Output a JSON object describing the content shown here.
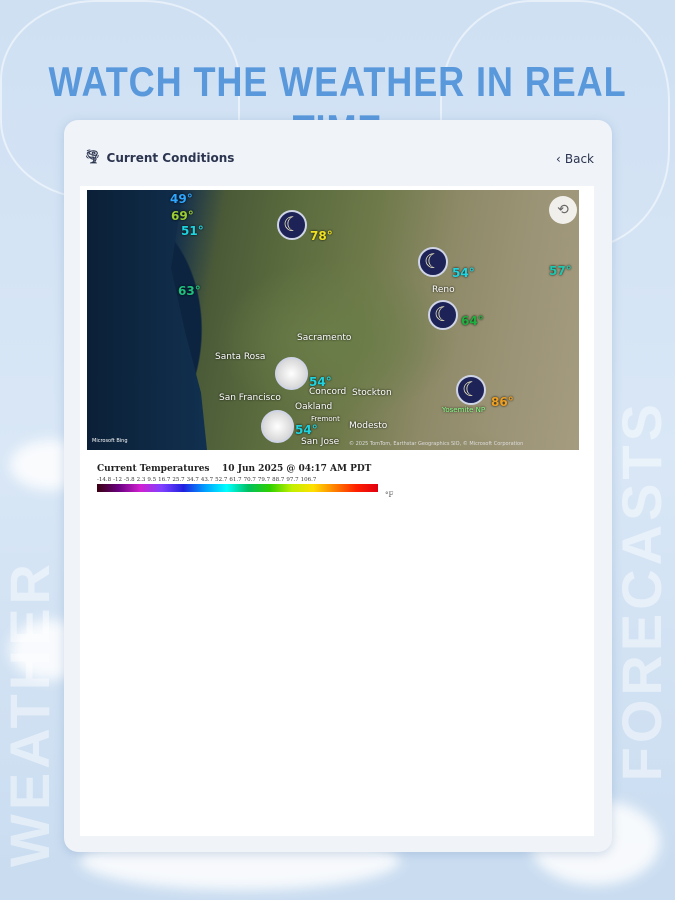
{
  "headline": "WATCH THE WEATHER IN REAL TIME",
  "side_left": "WEATHER",
  "side_right": "FORECASTS",
  "header": {
    "title": "Current Conditions",
    "back_label": "Back"
  },
  "map": {
    "temps": [
      {
        "v": "49°",
        "color": "#2ea6ff"
      },
      {
        "v": "69°",
        "color": "#9acd32"
      },
      {
        "v": "51°",
        "color": "#1ed4e0"
      },
      {
        "v": "78°",
        "color": "#f0e020"
      },
      {
        "v": "54°",
        "color": "#1ed4e0"
      },
      {
        "v": "57°",
        "color": "#1ec8b0"
      },
      {
        "v": "63°",
        "color": "#20c080"
      },
      {
        "v": "64°",
        "color": "#20b040"
      },
      {
        "v": "54°",
        "color": "#1ed4e0"
      },
      {
        "v": "86°",
        "color": "#f0a020"
      },
      {
        "v": "54°",
        "color": "#1ed4e0"
      }
    ],
    "cities": [
      "Sacramento",
      "Santa Rosa",
      "San Francisco",
      "Concord",
      "Oakland",
      "Stockton",
      "Fremont",
      "Modesto",
      "San Jose",
      "Reno",
      "Yosemite NP"
    ],
    "attribution": "Microsoft Bing",
    "copyright": "© 2025 TomTom, Earthstar Geographics SIO, © Microsoft Corporation"
  },
  "legend": {
    "title": "Current Temperatures",
    "timestamp": "10 Jun 2025 @ 04:17 AM PDT",
    "ticks": [
      "-14.8",
      "-12",
      "-5.8",
      "2.3",
      "9.5",
      "16.7",
      "25.7",
      "34.7",
      "43.7",
      "52.7",
      "61.7",
      "70.7",
      "79.7",
      "88.7",
      "97.7",
      "106.7"
    ],
    "unit": "°F"
  }
}
